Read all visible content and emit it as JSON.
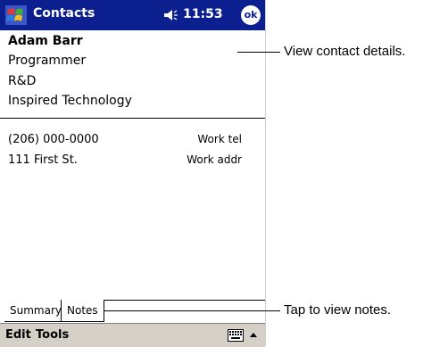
{
  "titlebar": {
    "app_title": "Contacts",
    "time": "11:53",
    "ok_label": "ok"
  },
  "contact": {
    "name": "Adam Barr",
    "title": "Programmer",
    "department": "R&D",
    "company": "Inspired Technology",
    "phone": "(206) 000-0000",
    "phone_label": "Work tel",
    "address": "111 First St.",
    "address_label": "Work addr"
  },
  "tabs": [
    {
      "label": "Summary"
    },
    {
      "label": "Notes"
    }
  ],
  "menu": {
    "items": [
      {
        "label": "Edit"
      },
      {
        "label": "Tools"
      }
    ]
  },
  "callouts": {
    "details": "View contact details.",
    "notes": "Tap to view notes."
  },
  "colors": {
    "titlebar": "#0c1f8f",
    "menubar": "#d4d0c8"
  },
  "icons": [
    "start-flag-icon",
    "speaker-icon",
    "keyboard-icon",
    "input-arrow-icon"
  ]
}
